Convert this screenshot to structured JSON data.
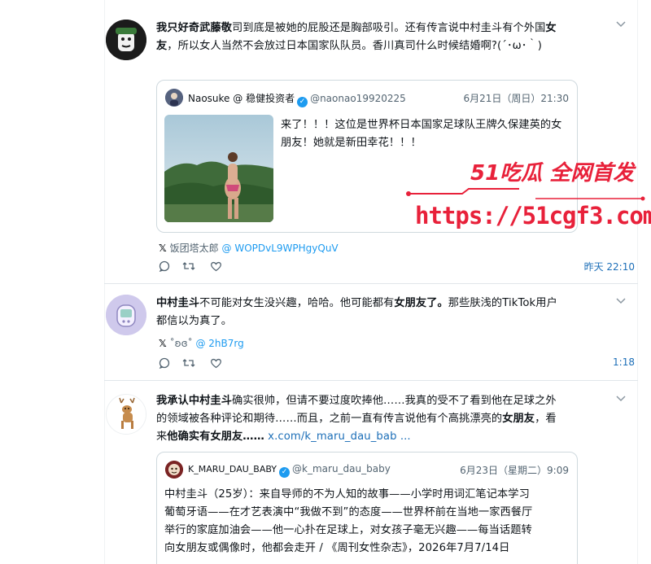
{
  "tweets": [
    {
      "author": "我只好奇武藤敬",
      "text1": "司到底是被她的屁股还是胸部吸引。还有传言说中村圭斗有个外国",
      "bold2": "女",
      "bold3": "友",
      "text2": "，所以女人当然不会放过日本国家队队员。香川真司什么时候结婚啊?(´･ω･｀)",
      "quote": {
        "name": "Naosuke @ 稳健投资者",
        "handle": "@naonao19920225",
        "date": "6月21日（周日）21:30",
        "text": "来了！！！这位是世界杯日本国家足球队王牌久保建英的女朋友！她就是新田幸花！！！"
      },
      "source_label": "饭团塔太郎",
      "source_handle": "@ WOPDvL9WPHgyQuV",
      "time": "昨天 22:10"
    },
    {
      "author": "中村圭斗",
      "text1": "不可能对女生没兴趣，哈哈。他可能都有",
      "bold2": "女朋友了。",
      "text2": "那些肤浅的TikTok用户",
      "text3": "都信以为真了。",
      "source_label": "˚ʚɞ˚",
      "source_handle": "@ 2hB7rg",
      "time": "1:18"
    },
    {
      "author": "我承认中村圭斗",
      "text1": "确实很帅，但请不要过度吹捧他……我真的受不了看到他在足球之外",
      "text2": "的领域被各种评论和期待……而且，之前一直有传言说他有个高挑漂亮的",
      "bold2": "女朋友",
      "text2b": "，看",
      "text3a": "来",
      "bold3": "他确实有女朋友……",
      "link": " x.com/k_maru_dau_bab ...",
      "quote": {
        "name": "K_MARU_DAU_BABY",
        "handle": "@k_maru_dau_baby",
        "date": "6月23日（星期二）9:09",
        "line1": "中村圭斗（25岁）：来自导师的不为人知的故事——小学时用词汇笔记本学习",
        "line2": "葡萄牙语——在才艺表演中“我做不到”的态度——世界杯前在当地一家西餐厅",
        "line3": "举行的家庭加油会——他一心扑在足球上，对女孩子毫无兴趣——每当话题转",
        "line4": "向女朋友或偶像时，他都会走开 / 《周刊女性杂志》，2026年7月7/14日"
      }
    }
  ],
  "watermark": {
    "brand": "51吃瓜 全网首发",
    "url": "https://51cgf3.com"
  },
  "colors": {
    "link": "#1d6fb8",
    "verified": "#1d9bf0",
    "watermark_red": "#e8213a"
  }
}
